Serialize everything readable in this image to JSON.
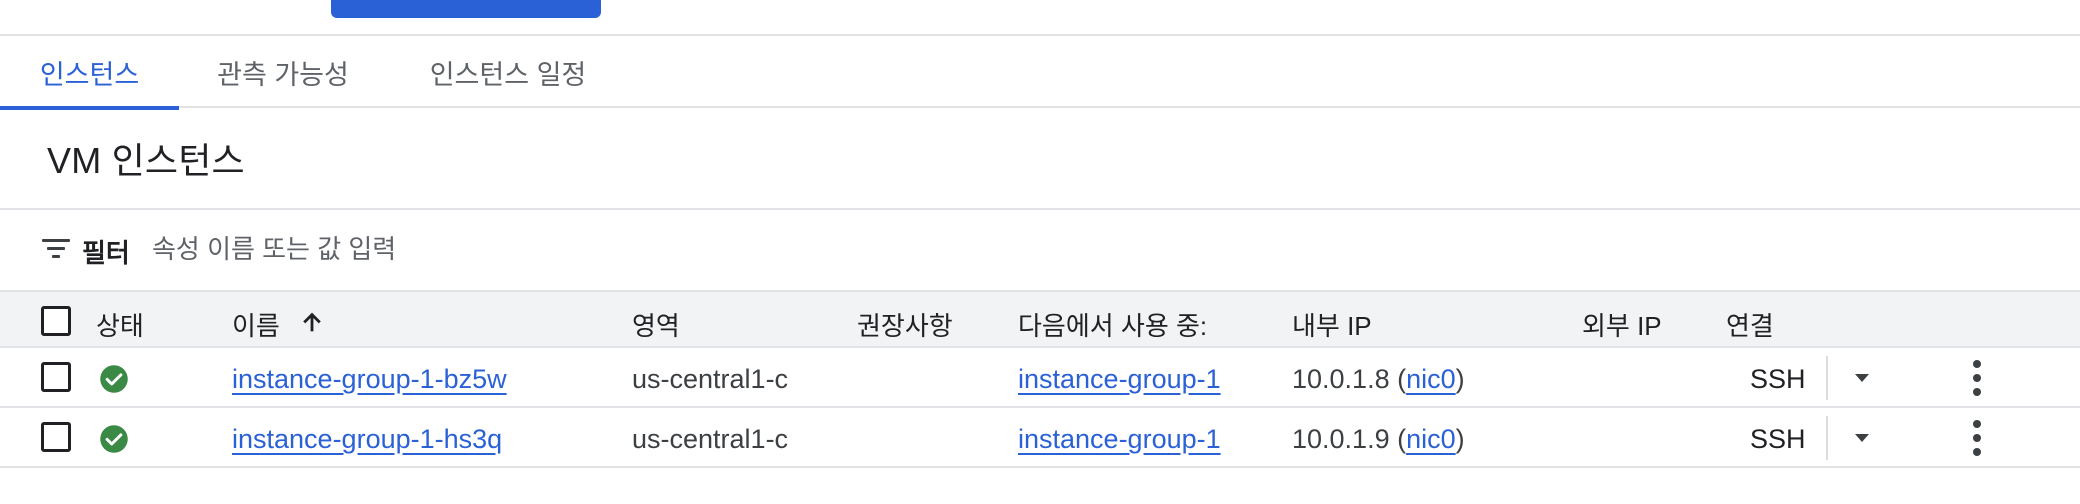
{
  "tabs": [
    {
      "label": "인스턴스",
      "active": true
    },
    {
      "label": "관측 가능성",
      "active": false
    },
    {
      "label": "인스턴스 일정",
      "active": false
    }
  ],
  "page": {
    "title": "VM 인스턴스"
  },
  "filter": {
    "label": "필터",
    "placeholder": "속성 이름 또는 값 입력"
  },
  "table": {
    "headers": {
      "status": "상태",
      "name": "이름",
      "zone": "영역",
      "recommendation": "권장사항",
      "in_use_by": "다음에서 사용 중:",
      "internal_ip": "내부 IP",
      "external_ip": "외부 IP",
      "connect": "연결"
    },
    "sort": {
      "column": "name",
      "direction": "ascending"
    },
    "rows": [
      {
        "status": "running",
        "name": "instance-group-1-bz5w",
        "zone": "us-central1-c",
        "recommendation": "",
        "in_use_by": "instance-group-1",
        "internal_ip": "10.0.1.8",
        "nic": "nic0",
        "external_ip": "",
        "connect": "SSH"
      },
      {
        "status": "running",
        "name": "instance-group-1-hs3q",
        "zone": "us-central1-c",
        "recommendation": "",
        "in_use_by": "instance-group-1",
        "internal_ip": "10.0.1.9",
        "nic": "nic0",
        "external_ip": "",
        "connect": "SSH"
      }
    ]
  },
  "colors": {
    "accent": "#2b61d6",
    "status_ok": "#34a853",
    "divider": "#e1e3e6",
    "header_bg": "#f1f3f4"
  },
  "icons": {
    "filter": "filter-list-icon",
    "sort": "arrow-upward-icon",
    "status": "check-circle-icon",
    "caret": "arrow-drop-down-icon",
    "more": "more-vert-icon"
  }
}
